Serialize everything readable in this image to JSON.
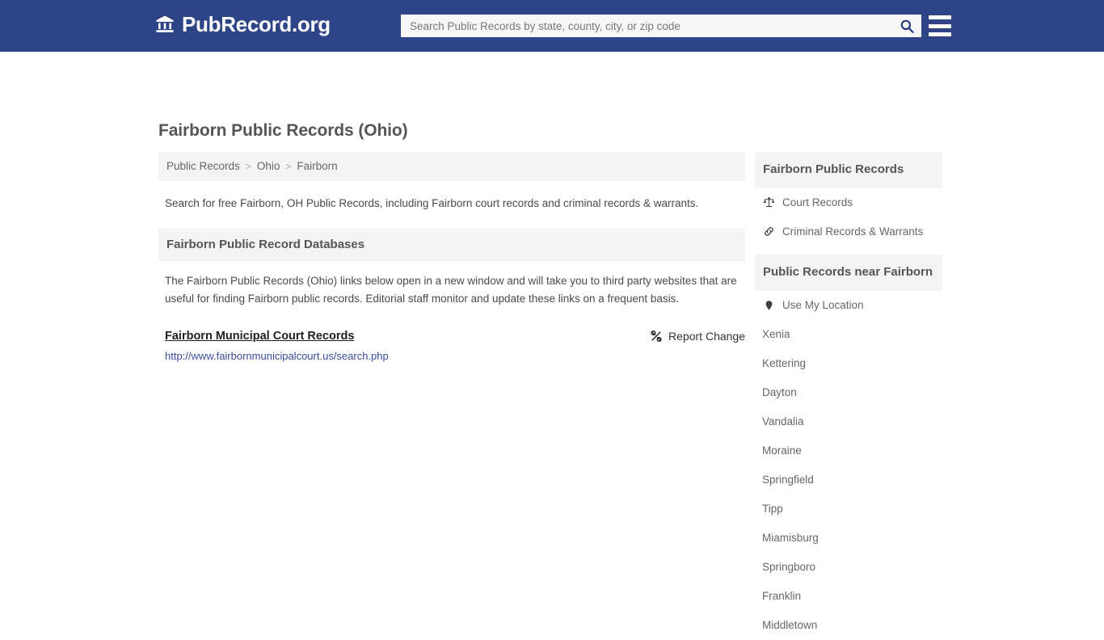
{
  "header": {
    "brand_icon": "bank-building-icon",
    "brand_name": "PubRecord.org",
    "search": {
      "placeholder": "Search Public Records by state, county, city, or zip code",
      "value": "",
      "button_icon": "search-icon"
    },
    "menu_icon": "hamburger-menu-icon",
    "bg_color": "#2e4487"
  },
  "page": {
    "title": "Fairborn Public Records (Ohio)"
  },
  "breadcrumb": {
    "items": [
      {
        "label": "Public Records"
      },
      {
        "label": "Ohio"
      },
      {
        "label": "Fairborn"
      }
    ],
    "separator": ">"
  },
  "intro": {
    "text": "Search for free Fairborn, OH Public Records, including Fairborn court records and criminal records & warrants."
  },
  "databases_section": {
    "heading": "Fairborn Public Record Databases",
    "blurb": "The Fairborn Public Records (Ohio) links below open in a new window and will take you to third party websites that are useful for finding Fairborn public records. Editorial staff monitor and update these links on a frequent basis.",
    "records": [
      {
        "title": "Fairborn Municipal Court Records",
        "url": "http://www.fairbornmunicipalcourt.us/search.php",
        "report_label": "Report Change",
        "report_icon": "broken-link-icon"
      }
    ]
  },
  "sidebar": {
    "records_panel": {
      "heading": "Fairborn Public Records",
      "items": [
        {
          "label": "Court Records",
          "icon": "balance-scale-icon"
        },
        {
          "label": "Criminal Records & Warrants",
          "icon": "chain-link-icon"
        }
      ]
    },
    "nearby_panel": {
      "heading": "Public Records near Fairborn",
      "locate": {
        "label": "Use My Location",
        "icon": "map-pin-icon"
      },
      "cities": [
        {
          "label": "Xenia"
        },
        {
          "label": "Kettering"
        },
        {
          "label": "Dayton"
        },
        {
          "label": "Vandalia"
        },
        {
          "label": "Moraine"
        },
        {
          "label": "Springfield"
        },
        {
          "label": "Tipp"
        },
        {
          "label": "Miamisburg"
        },
        {
          "label": "Springboro"
        },
        {
          "label": "Franklin"
        },
        {
          "label": "Middletown"
        }
      ]
    }
  },
  "colors": {
    "brand_blue": "#2e4487",
    "panel_gray": "#f4f4f4",
    "link_blue": "#3a4a9c",
    "text_gray": "#666666"
  }
}
